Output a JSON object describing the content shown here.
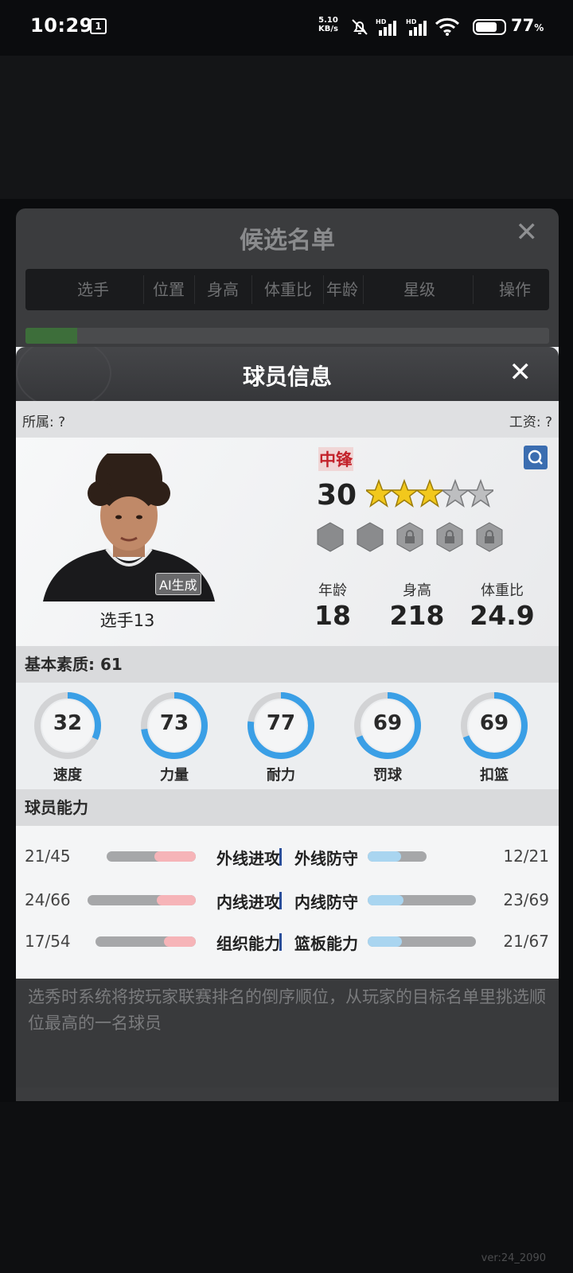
{
  "status_bar": {
    "time": "10:29",
    "notif_badge": "1",
    "speed_value": "5.10",
    "speed_unit": "KB/s",
    "battery_pct": "77",
    "battery_unit": "%"
  },
  "candidate_list": {
    "title": "候选名单",
    "columns": [
      "选手",
      "位置",
      "身高",
      "体重比",
      "年龄",
      "星级",
      "操作"
    ],
    "note": "选秀时系统将按玩家联赛排名的倒序顺位，从玩家的目标名单里挑选顺位最高的一名球员"
  },
  "player_info": {
    "title": "球员信息",
    "affiliation": "所属: ?",
    "salary": "工资: ?",
    "name": "选手13",
    "ai_tag": "AI生成",
    "position": "中锋",
    "rating": "30",
    "stars": 3.5,
    "attrs": [
      {
        "label": "年龄",
        "value": "18"
      },
      {
        "label": "身高",
        "value": "218"
      },
      {
        "label": "体重比",
        "value": "24.9"
      }
    ],
    "basic_quality_label": "基本素质: 61",
    "basic_quality": [
      {
        "label": "速度",
        "value": "32",
        "pct": 32
      },
      {
        "label": "力量",
        "value": "73",
        "pct": 73
      },
      {
        "label": "耐力",
        "value": "77",
        "pct": 77
      },
      {
        "label": "罚球",
        "value": "69",
        "pct": 69
      },
      {
        "label": "扣篮",
        "value": "69",
        "pct": 69
      }
    ],
    "ability_title": "球员能力",
    "abilities": [
      {
        "left_label": "外线进攻",
        "left_value": "21/45",
        "left_cur": 21,
        "left_max": 45,
        "right_label": "外线防守",
        "right_value": "12/21",
        "right_cur": 12,
        "right_max": 21
      },
      {
        "left_label": "内线进攻",
        "left_value": "24/66",
        "left_cur": 24,
        "left_max": 66,
        "right_label": "内线防守",
        "right_value": "23/69",
        "right_cur": 23,
        "right_max": 69
      },
      {
        "left_label": "组织能力",
        "left_value": "17/54",
        "left_cur": 17,
        "left_max": 54,
        "right_label": "篮板能力",
        "right_value": "21/67",
        "right_cur": 21,
        "right_max": 67
      }
    ]
  },
  "version": "ver:24_2090",
  "colors": {
    "ring_blue": "#3a9fe6",
    "ring_gray": "#d2d3d5",
    "position_red": "#c3222a",
    "attack_bar": "#f6b4b8",
    "defense_bar": "#a9d5f0"
  }
}
